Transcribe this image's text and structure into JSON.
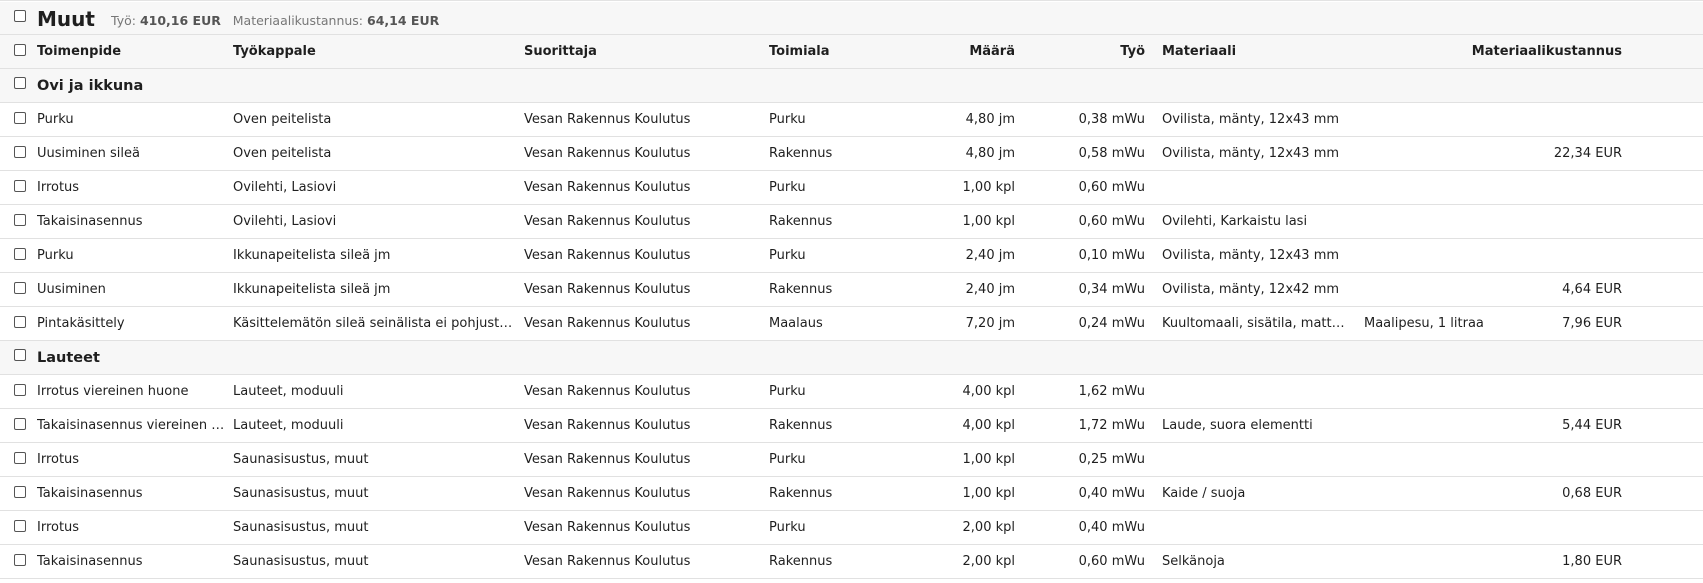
{
  "title": "Muut",
  "summary": {
    "work_label": "Työ:",
    "work_value": "410,16 EUR",
    "material_label": "Materiaalikustannus:",
    "material_value": "64,14 EUR"
  },
  "columns": {
    "operation": "Toimenpide",
    "workpiece": "Työkappale",
    "performer": "Suorittaja",
    "trade": "Toimiala",
    "quantity": "Määrä",
    "work": "Työ",
    "material": "Materiaali",
    "material_cost": "Materiaalikustannus"
  },
  "groups": [
    {
      "name": "Ovi ja ikkuna",
      "rows": [
        {
          "operation": "Purku",
          "workpiece": "Oven peitelista",
          "performer": "Vesan Rakennus Koulutus",
          "trade": "Purku",
          "quantity": "4,80 jm",
          "work": "0,38 mWu",
          "material": "Ovilista, mänty, 12x43 mm",
          "material2": "",
          "cost": ""
        },
        {
          "operation": "Uusiminen sileä",
          "workpiece": "Oven peitelista",
          "performer": "Vesan Rakennus Koulutus",
          "trade": "Rakennus",
          "quantity": "4,80 jm",
          "work": "0,58 mWu",
          "material": "Ovilista, mänty, 12x43 mm",
          "material2": "",
          "cost": "22,34 EUR"
        },
        {
          "operation": "Irrotus",
          "workpiece": "Ovilehti, Lasiovi",
          "performer": "Vesan Rakennus Koulutus",
          "trade": "Purku",
          "quantity": "1,00 kpl",
          "work": "0,60 mWu",
          "material": "",
          "material2": "",
          "cost": ""
        },
        {
          "operation": "Takaisinasennus",
          "workpiece": "Ovilehti, Lasiovi",
          "performer": "Vesan Rakennus Koulutus",
          "trade": "Rakennus",
          "quantity": "1,00 kpl",
          "work": "0,60 mWu",
          "material": "Ovilehti, Karkaistu lasi",
          "material2": "",
          "cost": ""
        },
        {
          "operation": "Purku",
          "workpiece": "Ikkunapeitelista sileä jm",
          "performer": "Vesan Rakennus Koulutus",
          "trade": "Purku",
          "quantity": "2,40 jm",
          "work": "0,10 mWu",
          "material": "Ovilista, mänty, 12x43 mm",
          "material2": "",
          "cost": ""
        },
        {
          "operation": "Uusiminen",
          "workpiece": "Ikkunapeitelista sileä jm",
          "performer": "Vesan Rakennus Koulutus",
          "trade": "Rakennus",
          "quantity": "2,40 jm",
          "work": "0,34 mWu",
          "material": "Ovilista, mänty, 12x42 mm",
          "material2": "",
          "cost": "4,64 EUR"
        },
        {
          "operation": "Pintakäsittely",
          "workpiece": "Käsittelemätön sileä seinälista ei pohjustusta...",
          "performer": "Vesan Rakennus Koulutus",
          "trade": "Maalaus",
          "quantity": "7,20 jm",
          "work": "0,24 mWu",
          "material": "Kuultomaali, sisätila, matta, ...",
          "material2": "Maalipesu, 1 litraa",
          "cost": "7,96 EUR"
        }
      ]
    },
    {
      "name": "Lauteet",
      "rows": [
        {
          "operation": "Irrotus viereinen huone",
          "workpiece": "Lauteet, moduuli",
          "performer": "Vesan Rakennus Koulutus",
          "trade": "Purku",
          "quantity": "4,00 kpl",
          "work": "1,62 mWu",
          "material": "",
          "material2": "",
          "cost": ""
        },
        {
          "operation": "Takaisinasennus viereinen hu...",
          "workpiece": "Lauteet, moduuli",
          "performer": "Vesan Rakennus Koulutus",
          "trade": "Rakennus",
          "quantity": "4,00 kpl",
          "work": "1,72 mWu",
          "material": "Laude, suora elementti",
          "material2": "",
          "cost": "5,44 EUR"
        },
        {
          "operation": "Irrotus",
          "workpiece": "Saunasisustus, muut",
          "performer": "Vesan Rakennus Koulutus",
          "trade": "Purku",
          "quantity": "1,00 kpl",
          "work": "0,25 mWu",
          "material": "",
          "material2": "",
          "cost": ""
        },
        {
          "operation": "Takaisinasennus",
          "workpiece": "Saunasisustus, muut",
          "performer": "Vesan Rakennus Koulutus",
          "trade": "Rakennus",
          "quantity": "1,00 kpl",
          "work": "0,40 mWu",
          "material": "Kaide / suoja",
          "material2": "",
          "cost": "0,68 EUR"
        },
        {
          "operation": "Irrotus",
          "workpiece": "Saunasisustus, muut",
          "performer": "Vesan Rakennus Koulutus",
          "trade": "Purku",
          "quantity": "2,00 kpl",
          "work": "0,40 mWu",
          "material": "",
          "material2": "",
          "cost": ""
        },
        {
          "operation": "Takaisinasennus",
          "workpiece": "Saunasisustus, muut",
          "performer": "Vesan Rakennus Koulutus",
          "trade": "Rakennus",
          "quantity": "2,00 kpl",
          "work": "0,60 mWu",
          "material": "Selkänoja",
          "material2": "",
          "cost": "1,80 EUR"
        }
      ]
    }
  ]
}
